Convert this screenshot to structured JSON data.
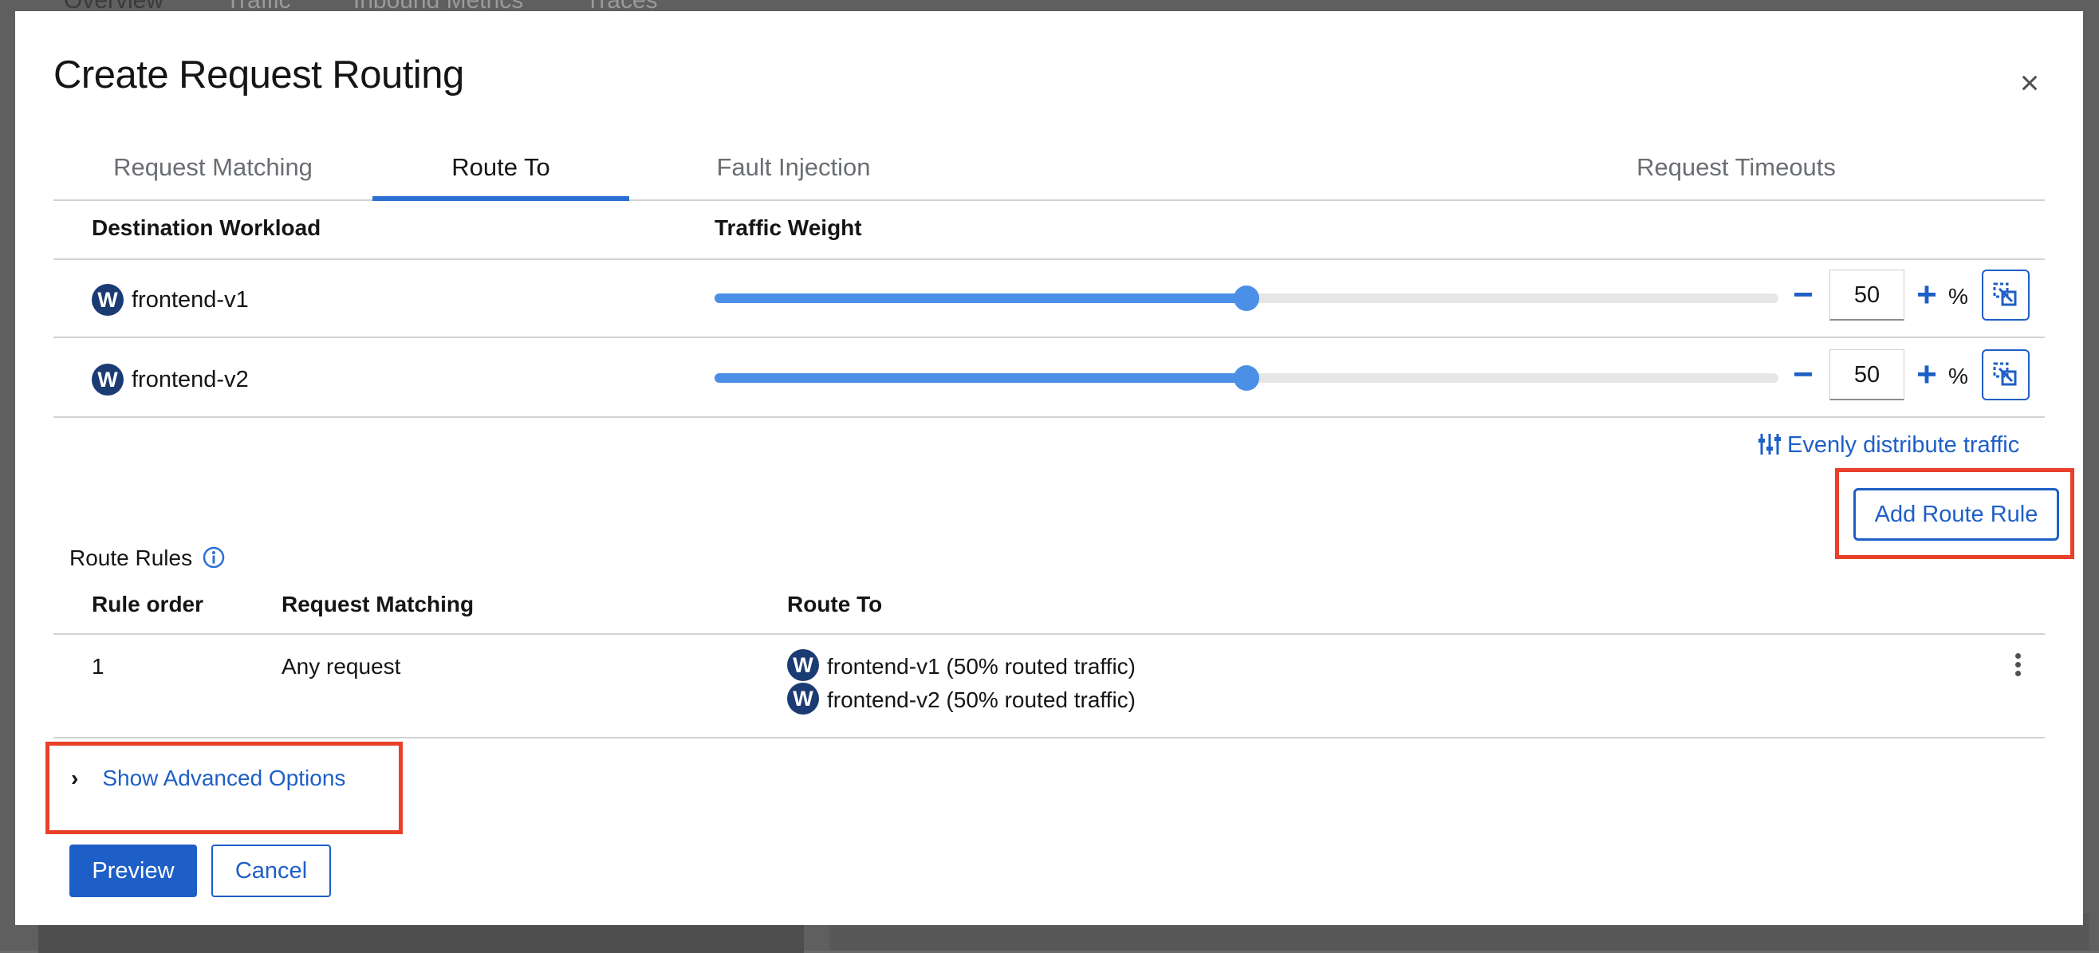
{
  "background": {
    "tabs": [
      "Overview",
      "Traffic",
      "Inbound Metrics",
      "Traces"
    ]
  },
  "modal": {
    "title": "Create Request Routing",
    "close_icon": "close-icon"
  },
  "tabs": [
    {
      "label": "Request Matching",
      "active": false
    },
    {
      "label": "Route To",
      "active": true
    },
    {
      "label": "Fault Injection",
      "active": false
    },
    {
      "label": "Request Timeouts",
      "active": false
    }
  ],
  "workloads": {
    "headers": {
      "destination": "Destination Workload",
      "weight": "Traffic Weight"
    },
    "rows": [
      {
        "badge": "W",
        "name": "frontend-v1",
        "weight": "50",
        "weight_fraction": 0.5,
        "unit": "%",
        "minus": "−",
        "plus": "+"
      },
      {
        "badge": "W",
        "name": "frontend-v2",
        "weight": "50",
        "weight_fraction": 0.5,
        "unit": "%",
        "minus": "−",
        "plus": "+"
      }
    ],
    "evenly_label": "Evenly distribute traffic"
  },
  "add_route_rule_label": "Add Route Rule",
  "route_rules": {
    "label": "Route Rules",
    "headers": {
      "order": "Rule order",
      "matching": "Request Matching",
      "route_to": "Route To"
    },
    "rows": [
      {
        "order": "1",
        "matching": "Any request",
        "routes": [
          {
            "badge": "W",
            "text": "frontend-v1 (50% routed traffic)"
          },
          {
            "badge": "W",
            "text": "frontend-v2 (50% routed traffic)"
          }
        ]
      }
    ]
  },
  "advanced": {
    "label": "Show Advanced Options"
  },
  "footer": {
    "preview": "Preview",
    "cancel": "Cancel"
  },
  "colors": {
    "primary": "#1e5fc7",
    "slider": "#4b8fe6",
    "badge": "#1b3b73",
    "highlight": "#e8402a"
  }
}
